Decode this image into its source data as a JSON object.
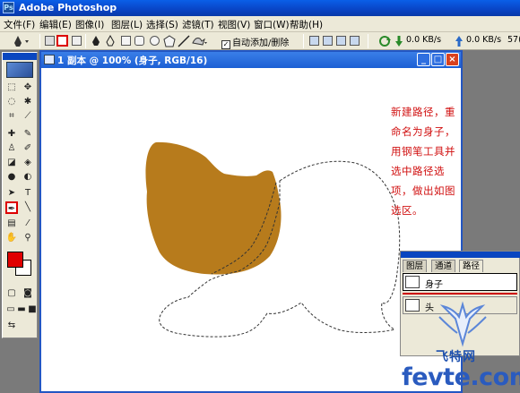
{
  "app": {
    "title": "Adobe Photoshop",
    "logo": "Ps"
  },
  "menu": [
    "文件(F)",
    "编辑(E)",
    "图像(I)",
    "图层(L)",
    "选择(S)",
    "滤镜(T)",
    "视图(V)",
    "窗口(W)",
    "帮助(H)"
  ],
  "options": {
    "auto_add_delete": "自动添加/删除",
    "auto_add_checked": true,
    "download_speed": "0.0 KB/s",
    "upload_speed": "0.0 KB/s",
    "extra_readout": "57("
  },
  "document": {
    "title": "1 副本 @ 100% (身子, RGB/16)",
    "instruction": "新建路径，重命名为身子，用钢笔工具并选中路径选项，做出如图选区。"
  },
  "paths_panel": {
    "tabs": [
      "图层",
      "通道",
      "路径"
    ],
    "active_tab": "路径",
    "paths": [
      {
        "name": "身子",
        "selected": true
      },
      {
        "name": "头",
        "selected": false
      }
    ]
  },
  "colors": {
    "foreground": "#e00000",
    "background": "#ffffff",
    "head_fill": "#b77b1c",
    "instruction_text": "#d11010"
  },
  "watermark": {
    "chinese": "飞特网",
    "domain": "fevte.com"
  }
}
